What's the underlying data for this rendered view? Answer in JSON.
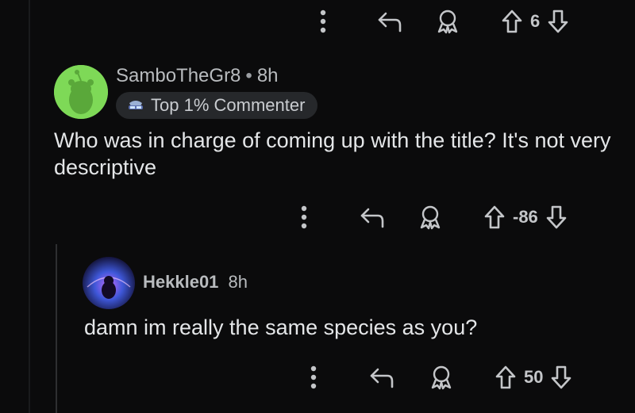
{
  "top_actions": {
    "more_icon": "more-vertical-icon",
    "reply_icon": "reply-arrow-icon",
    "award_icon": "award-icon",
    "upvote_icon": "arrow-up-icon",
    "downvote_icon": "arrow-down-icon",
    "score": "6"
  },
  "comments": [
    {
      "username": "SamboTheGr8",
      "separator": "•",
      "time": "8h",
      "badge": "Top 1% Commenter",
      "badge_icon": "commenter-badge-icon",
      "avatar_color": "#7ed957",
      "text": "Who was in charge of coming up with the title? It's not very descriptive",
      "score": "-86"
    },
    {
      "username": "Hekkle01",
      "time": "8h",
      "avatar_color": "#3a1f7a",
      "text": "damn im really the same species as you?",
      "score": "50"
    }
  ],
  "colors": {
    "background": "#0b0b0c",
    "icon": "#c4c6c9",
    "thread_line": "#2e2f31"
  }
}
